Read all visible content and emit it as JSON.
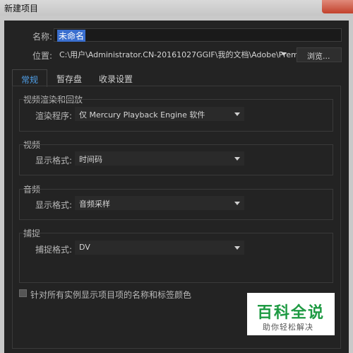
{
  "window": {
    "title": "新建项目"
  },
  "name": {
    "label": "名称:",
    "value": "未命名"
  },
  "location": {
    "label": "位置:",
    "value": "C:\\用户\\Administrator.CN-20161027GGIF\\我的文档\\Adobe\\Prem",
    "browse_label": "浏览..."
  },
  "tabs": [
    {
      "label": "常规",
      "active": true
    },
    {
      "label": "暂存盘",
      "active": false
    },
    {
      "label": "收录设置",
      "active": false
    }
  ],
  "groups": {
    "render": {
      "title": "视频渲染和回放",
      "field_label": "渲染程序:",
      "value": "仅 Mercury Playback Engine 软件"
    },
    "video": {
      "title": "视频",
      "field_label": "显示格式:",
      "value": "时间码"
    },
    "audio": {
      "title": "音频",
      "field_label": "显示格式:",
      "value": "音频采样"
    },
    "capture": {
      "title": "捕捉",
      "field_label": "捕捉格式:",
      "value": "DV"
    }
  },
  "checkbox": {
    "label": "针对所有实例显示项目项的名称和标签颜色",
    "checked": false
  },
  "watermark": {
    "line1": "百科全说",
    "line2": "助你轻松解决"
  },
  "colors": {
    "accent": "#4f9fe8",
    "selection": "#3a6fcf",
    "background": "#232323",
    "watermark_green": "#1d9a42"
  }
}
